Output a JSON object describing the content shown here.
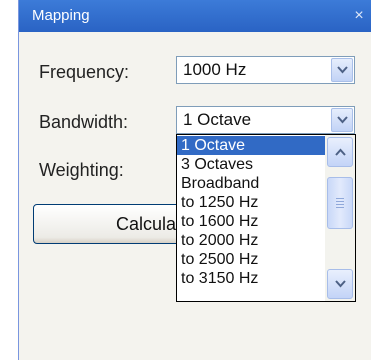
{
  "window": {
    "title": "Mapping",
    "close_glyph": "×"
  },
  "fields": {
    "frequency": {
      "label": "Frequency:",
      "value": "1000 Hz"
    },
    "bandwidth": {
      "label": "Bandwidth:",
      "value": "1 Octave"
    },
    "weighting": {
      "label": "Weighting:"
    }
  },
  "calculate_button": {
    "label": "Calcula"
  },
  "dropdown": {
    "items": [
      "1 Octave",
      "3 Octaves",
      "Broadband",
      "to 1250 Hz",
      "to 1600 Hz",
      "to 2000 Hz",
      "to 2500 Hz",
      "to 3150 Hz"
    ],
    "selected_index": 0
  },
  "icons": {
    "combo_arrow": "chevron-down-icon",
    "scroll_up": "chevron-up-icon",
    "scroll_down": "chevron-down-icon",
    "close": "close-icon"
  },
  "colors": {
    "titlebar": "#2a63c4",
    "selection": "#316ac5"
  }
}
